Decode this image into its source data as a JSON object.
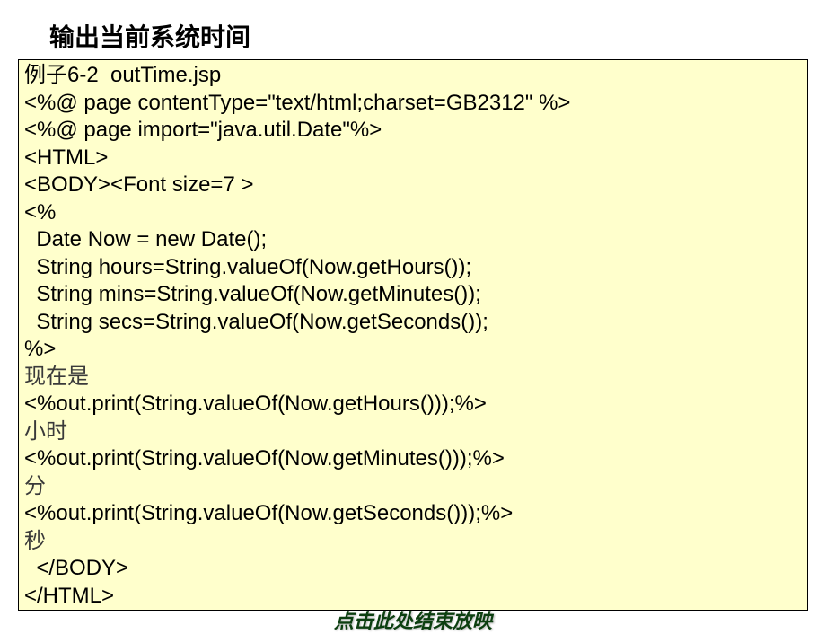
{
  "title": "输出当前系统时间",
  "code": {
    "line1": "例子6-2  outTime.jsp",
    "line2": "<%@ page contentType=\"text/html;charset=GB2312\" %>",
    "line3": "<%@ page import=\"java.util.Date\"%>",
    "line4": "<HTML>",
    "line5": "<BODY><Font size=7 >",
    "line6": "<%",
    "line7": "  Date Now = new Date();",
    "line8": "  String hours=String.valueOf(Now.getHours());",
    "line9": "  String mins=String.valueOf(Now.getMinutes());",
    "line10": "  String secs=String.valueOf(Now.getSeconds());",
    "line11": "%>",
    "line12": "现在是",
    "line13": "<%out.print(String.valueOf(Now.getHours()));%>",
    "line14": "小时",
    "line15": "<%out.print(String.valueOf(Now.getMinutes()));%>",
    "line16": "分",
    "line17": "<%out.print(String.valueOf(Now.getSeconds()));%>",
    "line18": "秒",
    "line19": "  </BODY>",
    "line20": "</HTML>"
  },
  "footer": "点击此处结束放映"
}
